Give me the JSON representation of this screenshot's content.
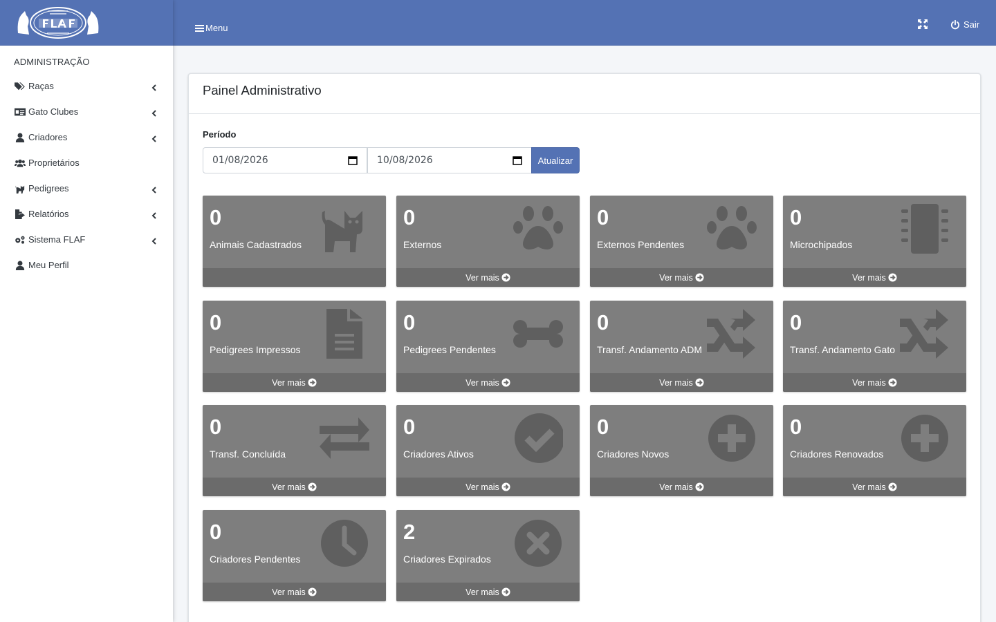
{
  "brand": {
    "logo_alt": "FLAF"
  },
  "sidebar": {
    "header": "ADMINISTRAÇÃO",
    "items": [
      {
        "label": "Raças",
        "icon": "tags-icon",
        "expandable": true
      },
      {
        "label": "Gato Clubes",
        "icon": "id-card-icon",
        "expandable": true
      },
      {
        "label": "Criadores",
        "icon": "user-icon",
        "expandable": true
      },
      {
        "label": "Proprietários",
        "icon": "users-icon",
        "expandable": false
      },
      {
        "label": "Pedigrees",
        "icon": "cat-icon",
        "expandable": true
      },
      {
        "label": "Relatórios",
        "icon": "file-export-icon",
        "expandable": true
      },
      {
        "label": "Sistema FLAF",
        "icon": "cogs-icon",
        "expandable": true
      },
      {
        "label": "Meu Perfil",
        "icon": "user-icon",
        "expandable": false
      }
    ]
  },
  "topbar": {
    "menu_label": "Menu",
    "logout_label": "Sair"
  },
  "main": {
    "title": "Painel Administrativo",
    "period_label": "Período",
    "start_date": "01/08/2026",
    "end_date": "10/08/2026",
    "update_label": "Atualizar",
    "more_label": "Ver mais",
    "boxes": [
      {
        "value": "0",
        "label": "Animais Cadastrados",
        "icon": "cat-icon",
        "has_footer_label": false
      },
      {
        "value": "0",
        "label": "Externos",
        "icon": "paw-icon",
        "has_footer_label": true
      },
      {
        "value": "0",
        "label": "Externos Pendentes",
        "icon": "paw-icon",
        "has_footer_label": true
      },
      {
        "value": "0",
        "label": "Microchipados",
        "icon": "microchip-icon",
        "has_footer_label": true
      },
      {
        "value": "0",
        "label": "Pedigrees Impressos",
        "icon": "file-icon",
        "has_footer_label": true
      },
      {
        "value": "0",
        "label": "Pedigrees Pendentes",
        "icon": "bone-icon",
        "has_footer_label": true
      },
      {
        "value": "0",
        "label": "Transf. Andamento ADM",
        "icon": "random-icon",
        "has_footer_label": true
      },
      {
        "value": "0",
        "label": "Transf. Andamento Gato",
        "icon": "random-icon",
        "has_footer_label": true
      },
      {
        "value": "0",
        "label": "Transf. Concluída",
        "icon": "exchange-icon",
        "has_footer_label": true
      },
      {
        "value": "0",
        "label": "Criadores Ativos",
        "icon": "check-circle-icon",
        "has_footer_label": true
      },
      {
        "value": "0",
        "label": "Criadores Novos",
        "icon": "plus-circle-icon",
        "has_footer_label": true
      },
      {
        "value": "0",
        "label": "Criadores Renovados",
        "icon": "plus-circle-icon",
        "has_footer_label": true
      },
      {
        "value": "0",
        "label": "Criadores Pendentes",
        "icon": "clock-icon",
        "has_footer_label": true
      },
      {
        "value": "2",
        "label": "Criadores Expirados",
        "icon": "times-circle-icon",
        "has_footer_label": true
      }
    ]
  },
  "colors": {
    "primary": "#5472b4",
    "box_bg": "#7e7e7e",
    "box_footer": "#6b6b6b",
    "box_icon": "#5f5f5f"
  }
}
